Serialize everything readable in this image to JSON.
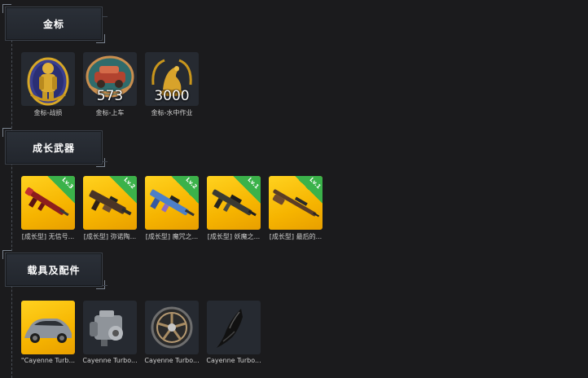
{
  "sections": [
    {
      "title": "金标",
      "items": [
        {
          "caption": "金标-战损",
          "number": ""
        },
        {
          "caption": "金标-上车",
          "number": "573"
        },
        {
          "caption": "金标-水中作业",
          "number": "3000"
        }
      ]
    },
    {
      "title": "成长武器",
      "items": [
        {
          "caption": "[成长型] 无信号...",
          "level": "Lv.3"
        },
        {
          "caption": "[成长型] 弥诺陶...",
          "level": "Lv.2"
        },
        {
          "caption": "[成长型] 魔咒之...",
          "level": "Lv.2"
        },
        {
          "caption": "[成长型] 妖魔之...",
          "level": "Lv.1"
        },
        {
          "caption": "[成长型] 最后的...",
          "level": "Lv.1"
        }
      ]
    },
    {
      "title": "载具及配件",
      "items": [
        {
          "caption": "\"Cayenne Turb..."
        },
        {
          "caption": "Cayenne Turbo..."
        },
        {
          "caption": "Cayenne Turbo..."
        },
        {
          "caption": "Cayenne Turbo..."
        }
      ]
    }
  ],
  "colors": {
    "background": "#1b1b1d",
    "gold_tile": "#f6b400",
    "level_badge": "#3bb24a"
  }
}
